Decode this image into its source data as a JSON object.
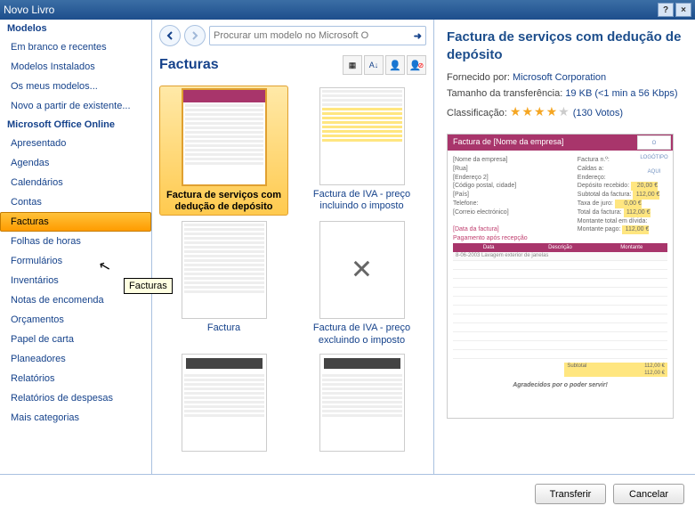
{
  "titlebar": {
    "text": "Novo Livro"
  },
  "sidebar": {
    "header1": "Modelos",
    "items1": [
      "Em branco e recentes",
      "Modelos Instalados",
      "Os meus modelos...",
      "Novo a partir de existente..."
    ],
    "header2": "Microsoft Office Online",
    "items2": [
      "Apresentado",
      "Agendas",
      "Calendários",
      "Contas",
      "Facturas",
      "Folhas de horas",
      "Formulários",
      "Inventários",
      "Notas de encomenda",
      "Orçamentos",
      "Papel de carta",
      "Planeadores",
      "Relatórios",
      "Relatórios de despesas",
      "Mais categorias"
    ],
    "selected": "Facturas"
  },
  "search": {
    "placeholder": "Procurar um modelo no Microsoft O"
  },
  "section": {
    "title": "Facturas"
  },
  "gallery": {
    "items": [
      {
        "label": "Factura de serviços com dedução de depósito",
        "selected": true,
        "style": "purple"
      },
      {
        "label": "Factura de IVA - preço incluindo o imposto",
        "style": "yellow"
      },
      {
        "label": "Factura",
        "style": "plain"
      },
      {
        "label": "Factura de IVA - preço excluindo o imposto",
        "style": "x"
      },
      {
        "label": "",
        "style": "bar"
      },
      {
        "label": "",
        "style": "bar"
      }
    ]
  },
  "preview": {
    "title": "Factura de serviços com dedução de depósito",
    "provided_label": "Fornecido por:",
    "provided_by": "Microsoft Corporation",
    "size_label": "Tamanho da transferência:",
    "size_value": "19 KB (<1 min a 56 Kbps)",
    "rating_label": "Classificação:",
    "rating_stars": 4,
    "rating_count": "(130 Votos)",
    "doc": {
      "header": "Factura de [Nome da empresa]",
      "logo": "O LOGÓTIPO AQUI",
      "left": [
        "[Nome da empresa]",
        "[Rua]",
        "[Endereço 2]",
        "[Código postal, cidade]",
        "[País]",
        "Telefone:",
        "[Correio electrónico]",
        "",
        "[Data da factura]",
        "Pagamento após recepção"
      ],
      "right_labels": [
        "Factura n.º:",
        "Caldas a:",
        "Endereço:",
        "",
        "Depósito recebido:",
        "Subtotal da factura:",
        "Taxa de juro:",
        "Total da factura:",
        "Montante total em dívida:",
        "Montante pago:"
      ],
      "right_values": [
        "",
        "",
        "",
        "",
        "20,00 €",
        "112,00 €",
        "0,00 €",
        "112,00 €",
        "",
        "112,00 €"
      ],
      "table_headers": [
        "Data",
        "Descrição",
        "Montante"
      ],
      "table_first_row": "8-06-2003 Lavagem exterior de janelas",
      "totals": [
        {
          "label": "Subtotal",
          "value": "112,00 €",
          "hl": true
        },
        {
          "label": "",
          "value": "112,00 €",
          "hl": true
        }
      ],
      "footer": "Agradecidos por o poder servir!"
    }
  },
  "buttons": {
    "transfer": "Transferir",
    "cancel": "Cancelar"
  },
  "tooltip": "Facturas"
}
